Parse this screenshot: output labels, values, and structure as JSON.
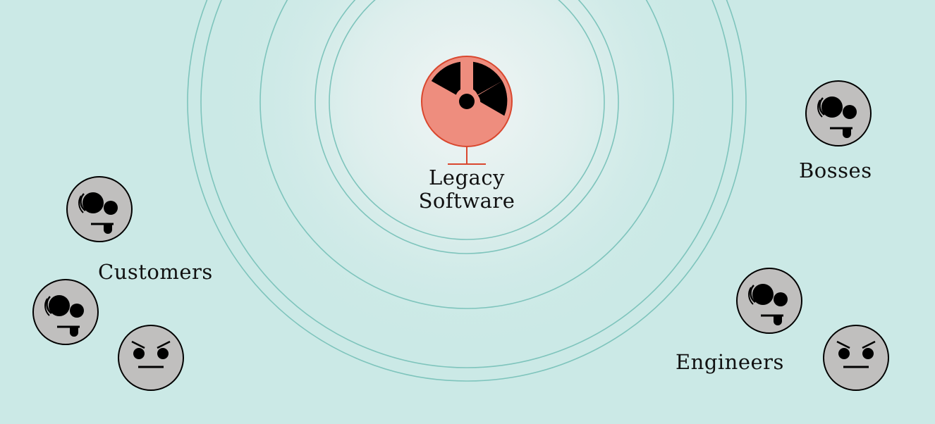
{
  "diagram": {
    "center_label_line1": "Legacy",
    "center_label_line2": "Software",
    "groups": {
      "bosses": "Bosses",
      "customers": "Customers",
      "engineers": "Engineers"
    }
  },
  "colors": {
    "background": "#cbe9e6",
    "ring": "#7ec4bc",
    "hazard_fill": "#ee8d7e",
    "hazard_stroke": "#d9472e",
    "face_fill": "#c0bfbe",
    "ink": "#000000"
  },
  "icons": {
    "center": "radiation-hazard-icon",
    "silly_face": "tongue-out-face-icon",
    "angry_face": "angry-face-icon"
  }
}
